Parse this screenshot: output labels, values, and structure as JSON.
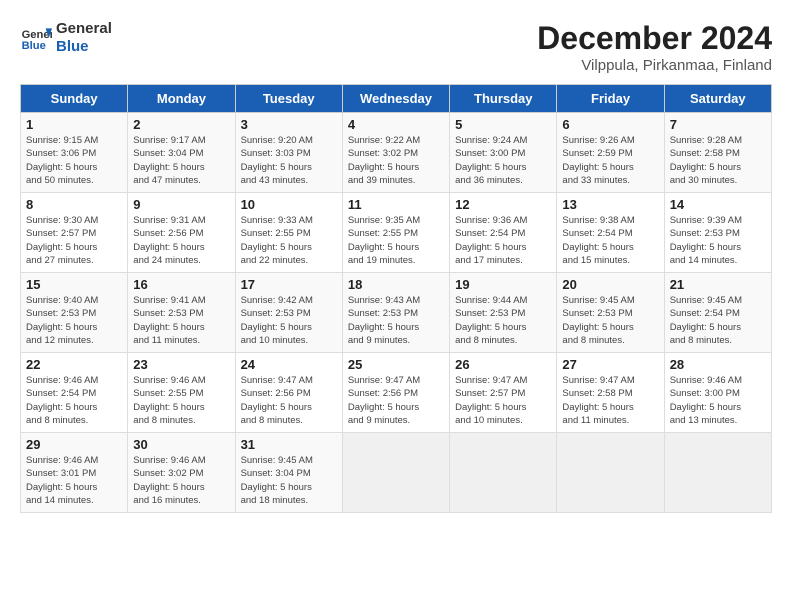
{
  "logo": {
    "text_general": "General",
    "text_blue": "Blue"
  },
  "title": "December 2024",
  "subtitle": "Vilppula, Pirkanmaa, Finland",
  "header": {
    "days": [
      "Sunday",
      "Monday",
      "Tuesday",
      "Wednesday",
      "Thursday",
      "Friday",
      "Saturday"
    ]
  },
  "weeks": [
    [
      {
        "day": "1",
        "info": "Sunrise: 9:15 AM\nSunset: 3:06 PM\nDaylight: 5 hours\nand 50 minutes."
      },
      {
        "day": "2",
        "info": "Sunrise: 9:17 AM\nSunset: 3:04 PM\nDaylight: 5 hours\nand 47 minutes."
      },
      {
        "day": "3",
        "info": "Sunrise: 9:20 AM\nSunset: 3:03 PM\nDaylight: 5 hours\nand 43 minutes."
      },
      {
        "day": "4",
        "info": "Sunrise: 9:22 AM\nSunset: 3:02 PM\nDaylight: 5 hours\nand 39 minutes."
      },
      {
        "day": "5",
        "info": "Sunrise: 9:24 AM\nSunset: 3:00 PM\nDaylight: 5 hours\nand 36 minutes."
      },
      {
        "day": "6",
        "info": "Sunrise: 9:26 AM\nSunset: 2:59 PM\nDaylight: 5 hours\nand 33 minutes."
      },
      {
        "day": "7",
        "info": "Sunrise: 9:28 AM\nSunset: 2:58 PM\nDaylight: 5 hours\nand 30 minutes."
      }
    ],
    [
      {
        "day": "8",
        "info": "Sunrise: 9:30 AM\nSunset: 2:57 PM\nDaylight: 5 hours\nand 27 minutes."
      },
      {
        "day": "9",
        "info": "Sunrise: 9:31 AM\nSunset: 2:56 PM\nDaylight: 5 hours\nand 24 minutes."
      },
      {
        "day": "10",
        "info": "Sunrise: 9:33 AM\nSunset: 2:55 PM\nDaylight: 5 hours\nand 22 minutes."
      },
      {
        "day": "11",
        "info": "Sunrise: 9:35 AM\nSunset: 2:55 PM\nDaylight: 5 hours\nand 19 minutes."
      },
      {
        "day": "12",
        "info": "Sunrise: 9:36 AM\nSunset: 2:54 PM\nDaylight: 5 hours\nand 17 minutes."
      },
      {
        "day": "13",
        "info": "Sunrise: 9:38 AM\nSunset: 2:54 PM\nDaylight: 5 hours\nand 15 minutes."
      },
      {
        "day": "14",
        "info": "Sunrise: 9:39 AM\nSunset: 2:53 PM\nDaylight: 5 hours\nand 14 minutes."
      }
    ],
    [
      {
        "day": "15",
        "info": "Sunrise: 9:40 AM\nSunset: 2:53 PM\nDaylight: 5 hours\nand 12 minutes."
      },
      {
        "day": "16",
        "info": "Sunrise: 9:41 AM\nSunset: 2:53 PM\nDaylight: 5 hours\nand 11 minutes."
      },
      {
        "day": "17",
        "info": "Sunrise: 9:42 AM\nSunset: 2:53 PM\nDaylight: 5 hours\nand 10 minutes."
      },
      {
        "day": "18",
        "info": "Sunrise: 9:43 AM\nSunset: 2:53 PM\nDaylight: 5 hours\nand 9 minutes."
      },
      {
        "day": "19",
        "info": "Sunrise: 9:44 AM\nSunset: 2:53 PM\nDaylight: 5 hours\nand 8 minutes."
      },
      {
        "day": "20",
        "info": "Sunrise: 9:45 AM\nSunset: 2:53 PM\nDaylight: 5 hours\nand 8 minutes."
      },
      {
        "day": "21",
        "info": "Sunrise: 9:45 AM\nSunset: 2:54 PM\nDaylight: 5 hours\nand 8 minutes."
      }
    ],
    [
      {
        "day": "22",
        "info": "Sunrise: 9:46 AM\nSunset: 2:54 PM\nDaylight: 5 hours\nand 8 minutes."
      },
      {
        "day": "23",
        "info": "Sunrise: 9:46 AM\nSunset: 2:55 PM\nDaylight: 5 hours\nand 8 minutes."
      },
      {
        "day": "24",
        "info": "Sunrise: 9:47 AM\nSunset: 2:56 PM\nDaylight: 5 hours\nand 8 minutes."
      },
      {
        "day": "25",
        "info": "Sunrise: 9:47 AM\nSunset: 2:56 PM\nDaylight: 5 hours\nand 9 minutes."
      },
      {
        "day": "26",
        "info": "Sunrise: 9:47 AM\nSunset: 2:57 PM\nDaylight: 5 hours\nand 10 minutes."
      },
      {
        "day": "27",
        "info": "Sunrise: 9:47 AM\nSunset: 2:58 PM\nDaylight: 5 hours\nand 11 minutes."
      },
      {
        "day": "28",
        "info": "Sunrise: 9:46 AM\nSunset: 3:00 PM\nDaylight: 5 hours\nand 13 minutes."
      }
    ],
    [
      {
        "day": "29",
        "info": "Sunrise: 9:46 AM\nSunset: 3:01 PM\nDaylight: 5 hours\nand 14 minutes."
      },
      {
        "day": "30",
        "info": "Sunrise: 9:46 AM\nSunset: 3:02 PM\nDaylight: 5 hours\nand 16 minutes."
      },
      {
        "day": "31",
        "info": "Sunrise: 9:45 AM\nSunset: 3:04 PM\nDaylight: 5 hours\nand 18 minutes."
      },
      {
        "day": "",
        "info": ""
      },
      {
        "day": "",
        "info": ""
      },
      {
        "day": "",
        "info": ""
      },
      {
        "day": "",
        "info": ""
      }
    ]
  ]
}
